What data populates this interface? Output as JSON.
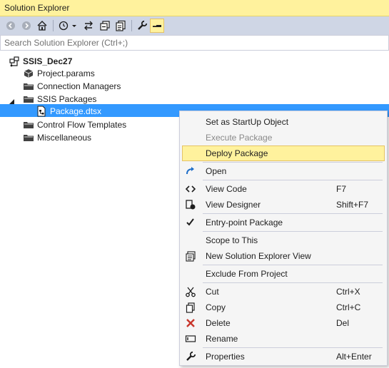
{
  "window": {
    "title": "Solution Explorer"
  },
  "toolbar": {
    "buttons": [
      "back-icon",
      "forward-icon",
      "home-icon",
      "pending-changes-icon",
      "sync-icon",
      "collapse-all-icon",
      "show-all-files-icon",
      "properties-icon",
      "preview-icon"
    ]
  },
  "search": {
    "placeholder": "Search Solution Explorer (Ctrl+;)"
  },
  "tree": {
    "root": "SSIS_Dec27",
    "items": {
      "project_params": "Project.params",
      "connection_managers": "Connection Managers",
      "ssis_packages": "SSIS Packages",
      "package": "Package.dtsx",
      "control_flow_templates": "Control Flow Templates",
      "miscellaneous": "Miscellaneous"
    }
  },
  "context_menu": {
    "set_startup": "Set as StartUp Object",
    "execute_package": "Execute Package",
    "deploy_package": "Deploy Package",
    "open": "Open",
    "view_code": "View Code",
    "view_code_key": "F7",
    "view_designer": "View Designer",
    "view_designer_key": "Shift+F7",
    "entry_point": "Entry-point Package",
    "scope_to_this": "Scope to This",
    "new_view": "New Solution Explorer View",
    "exclude": "Exclude From Project",
    "cut": "Cut",
    "cut_key": "Ctrl+X",
    "copy": "Copy",
    "copy_key": "Ctrl+C",
    "delete": "Delete",
    "delete_key": "Del",
    "rename": "Rename",
    "properties": "Properties",
    "properties_key": "Alt+Enter"
  },
  "colors": {
    "title_bg": "#fff29d",
    "toolbar_bg": "#cfd6e5",
    "selection": "#3399ff",
    "menu_highlight": "#fff29d",
    "delete_red": "#c8352b",
    "open_blue": "#1e6ec8"
  }
}
